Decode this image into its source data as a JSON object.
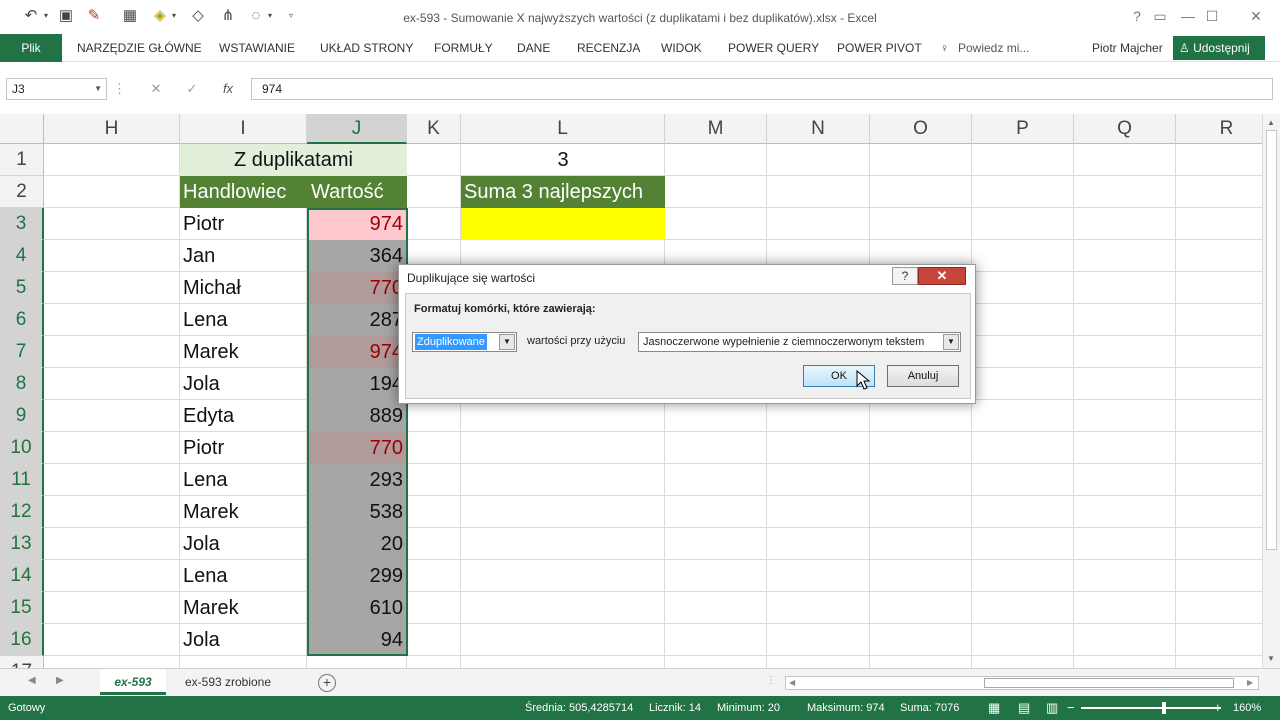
{
  "window": {
    "title": "ex-593 - Sumowanie X najwyższych wartości (z duplikatami i bez duplikatów).xlsx - Excel"
  },
  "quick_access": {
    "icons": [
      "undo-icon",
      "save-icon",
      "eraser-icon",
      "format-icon",
      "fill-icon",
      "shapes-icon",
      "tree-icon",
      "touch-icon",
      "customize-icon"
    ]
  },
  "ribbon": {
    "file": "Plik",
    "tabs": [
      "NARZĘDZIE GŁÓWNE",
      "WSTAWIANIE",
      "UKŁAD STRONY",
      "FORMUŁY",
      "DANE",
      "RECENZJA",
      "WIDOK",
      "POWER QUERY",
      "POWER PIVOT"
    ],
    "tell_me": "Powiedz mi...",
    "user": "Piotr Majcher",
    "share": "Udostępnij"
  },
  "formula_bar": {
    "name_box": "J3",
    "formula": "974"
  },
  "columns": [
    "H",
    "I",
    "J",
    "K",
    "L",
    "M",
    "N",
    "O",
    "P",
    "Q",
    "R"
  ],
  "rows": [
    "1",
    "2",
    "3",
    "4",
    "5",
    "6",
    "7",
    "8",
    "9",
    "10",
    "11",
    "12",
    "13",
    "14",
    "15",
    "16",
    "17"
  ],
  "cells": {
    "i1": "Z duplikatami",
    "i2": "Handlowiec",
    "j2": "Wartość",
    "l1": "3",
    "l2": "Suma 3 najlepszych"
  },
  "table": [
    {
      "name": "Piotr",
      "value": "974"
    },
    {
      "name": "Jan",
      "value": "364"
    },
    {
      "name": "Michał",
      "value": "770"
    },
    {
      "name": "Lena",
      "value": "287"
    },
    {
      "name": "Marek",
      "value": "974"
    },
    {
      "name": "Jola",
      "value": "194"
    },
    {
      "name": "Edyta",
      "value": "889"
    },
    {
      "name": "Piotr",
      "value": "770"
    },
    {
      "name": "Lena",
      "value": "293"
    },
    {
      "name": "Marek",
      "value": "538"
    },
    {
      "name": "Jola",
      "value": "20"
    },
    {
      "name": "Lena",
      "value": "299"
    },
    {
      "name": "Marek",
      "value": "610"
    },
    {
      "name": "Jola",
      "value": "94"
    }
  ],
  "dialog": {
    "title": "Duplikujące się wartości",
    "help": "?",
    "close": "✕",
    "label": "Formatuj komórki, które zawierają:",
    "type_value": "Zduplikowane",
    "middle_text": "wartości przy użyciu",
    "format_value": "Jasnoczerwone wypełnienie z ciemnoczerwonym tekstem",
    "ok": "OK",
    "cancel": "Anuluj"
  },
  "sheets": {
    "active": "ex-593",
    "other": "ex-593 zrobione",
    "add": "+"
  },
  "status": {
    "ready": "Gotowy",
    "average": "Średnia: 505,4285714",
    "count": "Licznik: 14",
    "min": "Minimum: 20",
    "max": "Maksimum: 974",
    "sum": "Suma: 7076",
    "zoom": "160%"
  },
  "colors": {
    "excel_green": "#217346",
    "header_green": "#548235",
    "dup_fill": "#ffc7ce",
    "dup_text": "#9c0006",
    "highlight": "#ffff00"
  }
}
